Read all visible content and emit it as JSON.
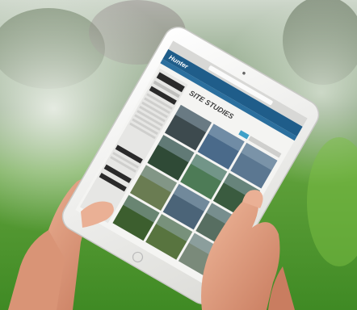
{
  "photo": {
    "subject": "hands-holding-tablet",
    "colors": {
      "grass": "#4f9a2c",
      "grass_light": "#8fcf4a",
      "foliage": "#3e5a3a",
      "sky_haze": "#d9e2d6",
      "skin": "#e8a98c",
      "skin_shadow": "#c77c61",
      "tablet_body": "#f3f3f1",
      "site_header": "#1f5d8a",
      "site_nav": "#2b6f9e"
    }
  },
  "website": {
    "logo": "Hunter",
    "heading": "SITE STUDIES",
    "thumbnails": [
      {
        "hue": "#3d4a4e"
      },
      {
        "hue": "#4a6a8a"
      },
      {
        "hue": "#5b7791"
      },
      {
        "hue": "#2f4a36"
      },
      {
        "hue": "#4d7b56"
      },
      {
        "hue": "#3a5b3f"
      },
      {
        "hue": "#6a7c52"
      },
      {
        "hue": "#4b6478"
      },
      {
        "hue": "#576e61"
      },
      {
        "hue": "#3c5e2e"
      },
      {
        "hue": "#58743f"
      },
      {
        "hue": "#7a8a7a"
      }
    ]
  }
}
